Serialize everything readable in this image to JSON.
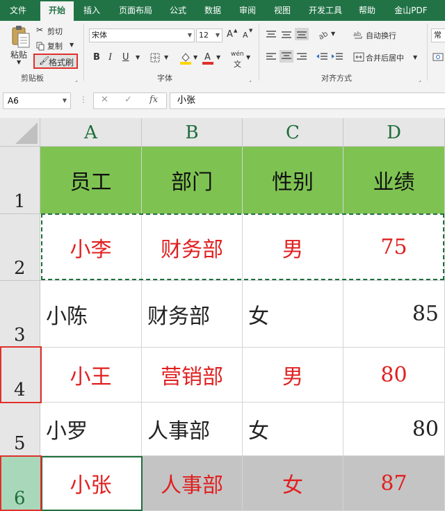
{
  "menu": {
    "tabs": [
      "文件",
      "开始",
      "插入",
      "页面布局",
      "公式",
      "数据",
      "审阅",
      "视图",
      "开发工具",
      "帮助",
      "金山PDF"
    ]
  },
  "ribbon": {
    "clipboard": {
      "paste": "粘贴",
      "cut": "剪切",
      "copy": "复制",
      "format_painter": "格式刷",
      "group_label": "剪贴板"
    },
    "font": {
      "font_name": "宋体",
      "font_size": "12",
      "grow": "A",
      "shrink": "A",
      "bold": "B",
      "italic": "I",
      "underline": "U",
      "phonetic": "wén",
      "group_label": "字体"
    },
    "alignment": {
      "wrap_text": "自动换行",
      "merge_center": "合并后居中",
      "group_label": "对齐方式"
    },
    "number": {
      "format": "常规"
    }
  },
  "formula_bar": {
    "name_box": "A6",
    "content": "小张"
  },
  "sheet": {
    "columns": [
      "A",
      "B",
      "C",
      "D"
    ],
    "rows": [
      "1",
      "2",
      "3",
      "4",
      "5",
      "6"
    ],
    "cells": [
      [
        "员工",
        "部门",
        "性别",
        "业绩"
      ],
      [
        "小李",
        "财务部",
        "男",
        "75"
      ],
      [
        "小陈",
        "财务部",
        "女",
        "85"
      ],
      [
        "小王",
        "营销部",
        "男",
        "80"
      ],
      [
        "小罗",
        "人事部",
        "女",
        "80"
      ],
      [
        "小张",
        "人事部",
        "女",
        "87"
      ]
    ]
  },
  "colors": {
    "accent": "#217346",
    "header_fill": "#7ec352",
    "highlight_text": "#e02020",
    "selection_fill": "#c4c4c4"
  }
}
